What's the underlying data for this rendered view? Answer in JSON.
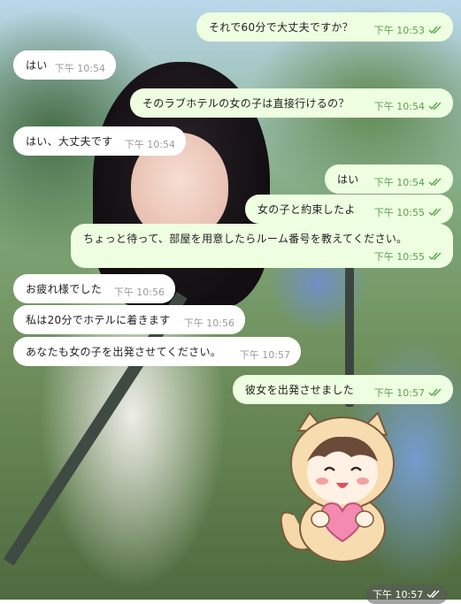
{
  "messages": [
    {
      "dir": "out",
      "text": "それで60分で大丈夫ですか？",
      "time": "下午 10:53",
      "read": true
    },
    {
      "dir": "in",
      "text": "はい",
      "time": "下午 10:54"
    },
    {
      "dir": "out",
      "text": "そのラブホテルの女の子は直接行けるの？",
      "time": "下午 10:54",
      "read": true
    },
    {
      "dir": "in",
      "text": "はい、大丈夫です",
      "time": "下午 10:54"
    },
    {
      "dir": "out",
      "text": "はい",
      "time": "下午 10:54",
      "read": true
    },
    {
      "dir": "out",
      "text": "女の子と約束したよ",
      "time": "下午 10:55",
      "read": true
    },
    {
      "dir": "out",
      "text": "ちょっと待って、部屋を用意したらルーム番号を教えてください。",
      "time": "下午 10:55",
      "read": true
    },
    {
      "dir": "in",
      "text": "お疲れ様でした",
      "time": "下午 10:56"
    },
    {
      "dir": "in",
      "text": "私は20分でホテルに着きます",
      "time": "下午 10:56"
    },
    {
      "dir": "in",
      "text": "あなたも女の子を出発させてください。",
      "time": "下午 10:57"
    },
    {
      "dir": "out",
      "text": "彼女を出発させました",
      "time": "下午 10:57",
      "read": true
    }
  ],
  "sticker": {
    "icon": "bear-hood-girl-heart-sticker",
    "time": "下午 10:57",
    "read": true
  },
  "colors": {
    "outgoing_bg": "#eefee0",
    "incoming_bg": "#ffffff",
    "read_check": "#59a34e",
    "time_incoming": "#9a9a9a"
  }
}
